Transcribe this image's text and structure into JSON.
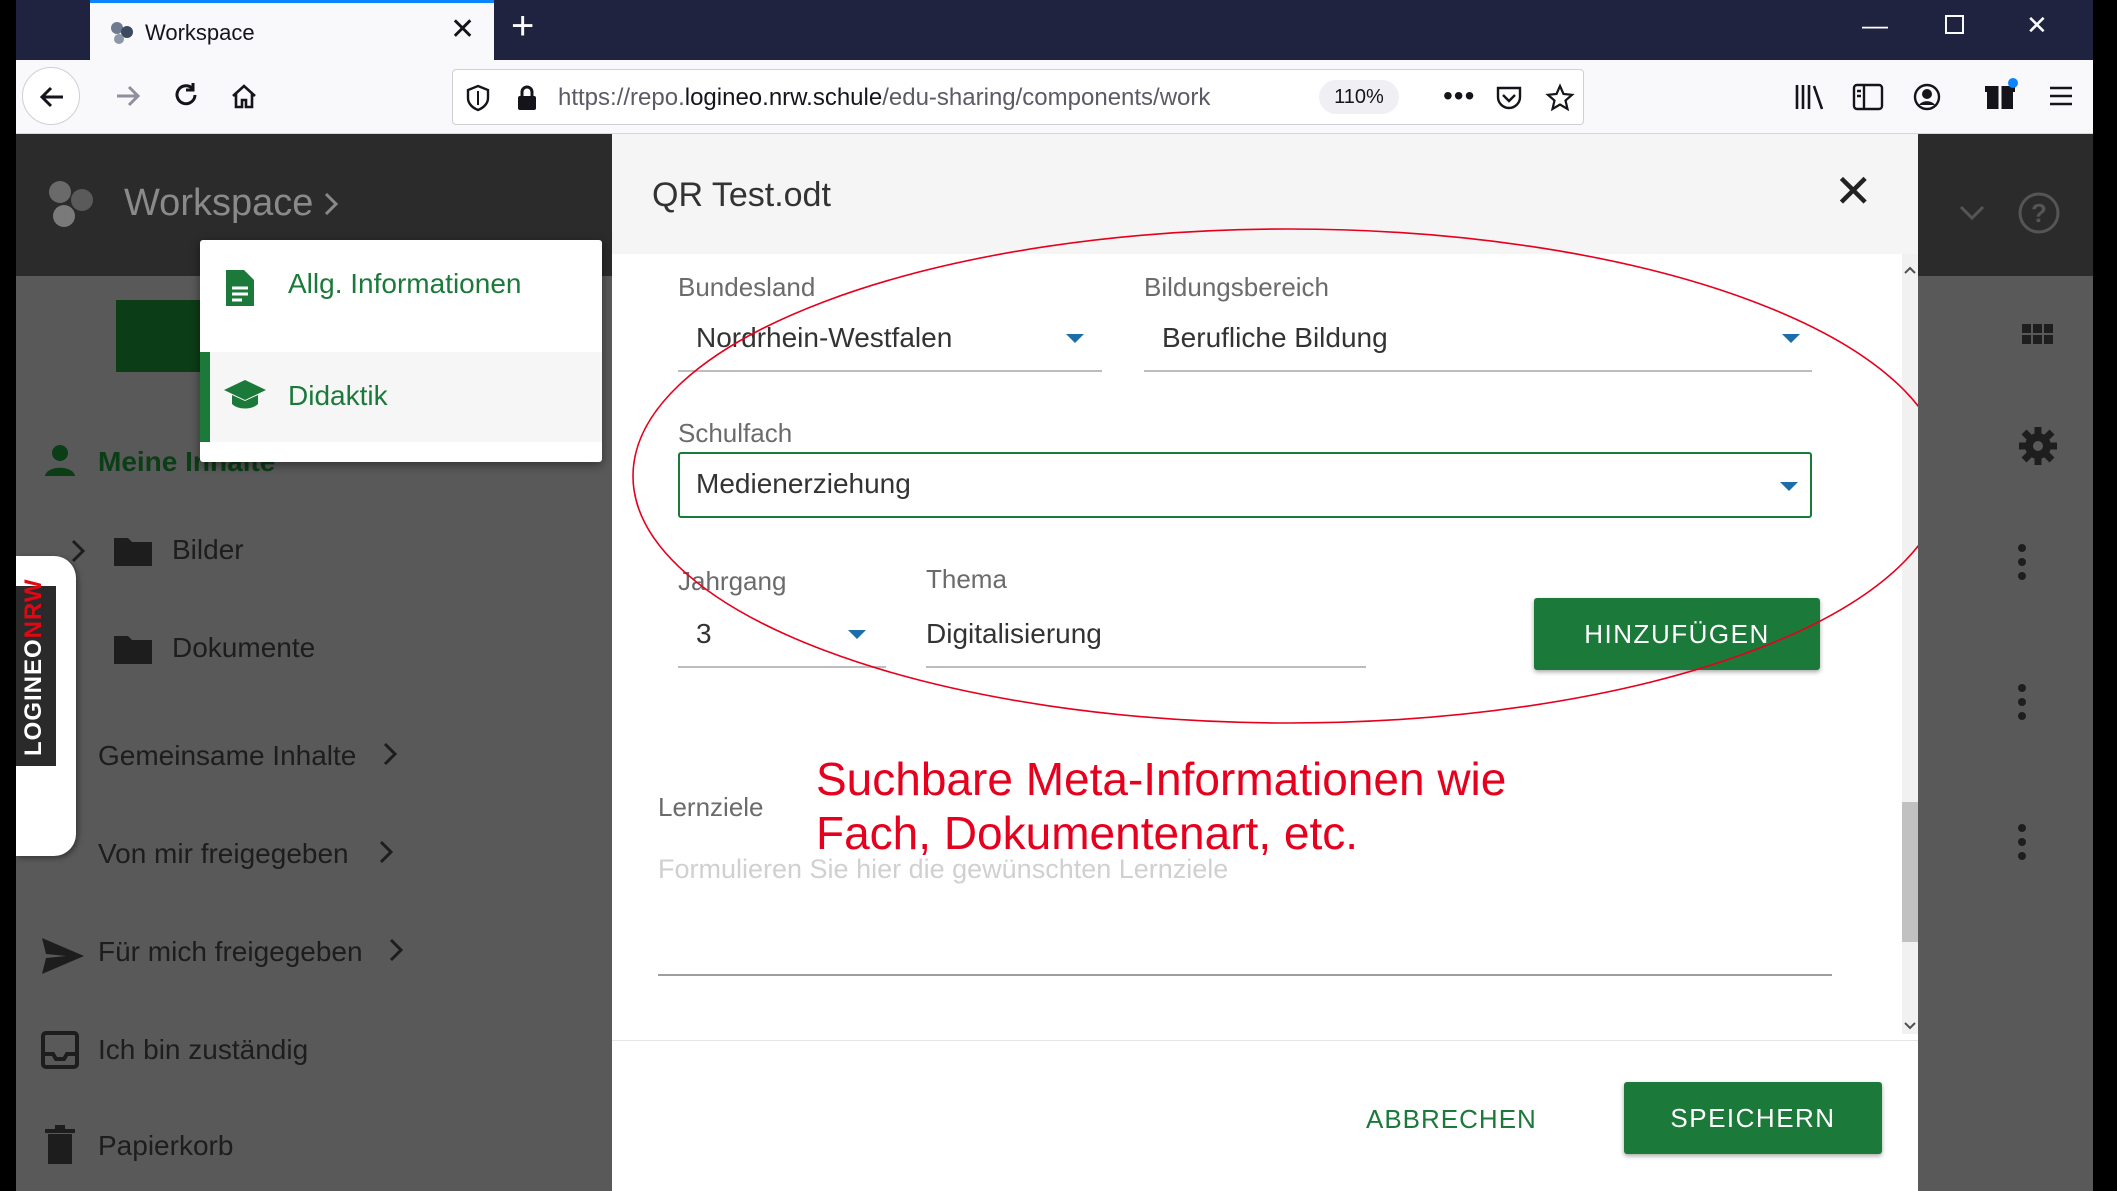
{
  "browser": {
    "tab_title": "Workspace",
    "url_prefix": "https://repo.",
    "url_domain": "logineo.nrw.schule",
    "url_path": "/edu-sharing/components/work",
    "zoom": "110%"
  },
  "app": {
    "header_title": "Workspace",
    "sidebar": {
      "my_contents": "Meine Inhalte",
      "folder_images": "Bilder",
      "folder_documents": "Dokumente",
      "shared": "Gemeinsame Inhalte",
      "shared_by_me": "Von mir freigegeben",
      "shared_with_me": "Für mich freigegeben",
      "responsible": "Ich bin zuständig",
      "trash": "Papierkorb"
    },
    "logo": {
      "part1": "LOGINEO",
      "part2": "NRW"
    }
  },
  "menu": {
    "items": [
      {
        "label": "Allg. Informationen",
        "icon": "document-icon"
      },
      {
        "label": "Didaktik",
        "icon": "graduation-cap-icon"
      }
    ]
  },
  "dialog": {
    "title": "QR Test.odt",
    "fields": {
      "bundesland": {
        "label": "Bundesland",
        "value": "Nordrhein-Westfalen"
      },
      "bildungsbereich": {
        "label": "Bildungsbereich",
        "value": "Berufliche Bildung"
      },
      "schulfach": {
        "label": "Schulfach",
        "value": "Medienerziehung"
      },
      "jahrgang": {
        "label": "Jahrgang",
        "value": "3"
      },
      "thema": {
        "label": "Thema",
        "value": "Digitalisierung"
      },
      "lernziele": {
        "label": "Lernziele",
        "placeholder": "Formulieren Sie hier die gewünschten Lernziele"
      }
    },
    "add_button": "HINZUFÜGEN",
    "cancel_button": "ABBRECHEN",
    "save_button": "SPEICHERN"
  },
  "annotation": {
    "line1": "Suchbare Meta-Informationen wie",
    "line2": "Fach, Dokumentenart, etc."
  },
  "colors": {
    "accent_green": "#1b7a3a",
    "annotation_red": "#e6001e",
    "dropdown_caret": "#1b6ea8"
  }
}
